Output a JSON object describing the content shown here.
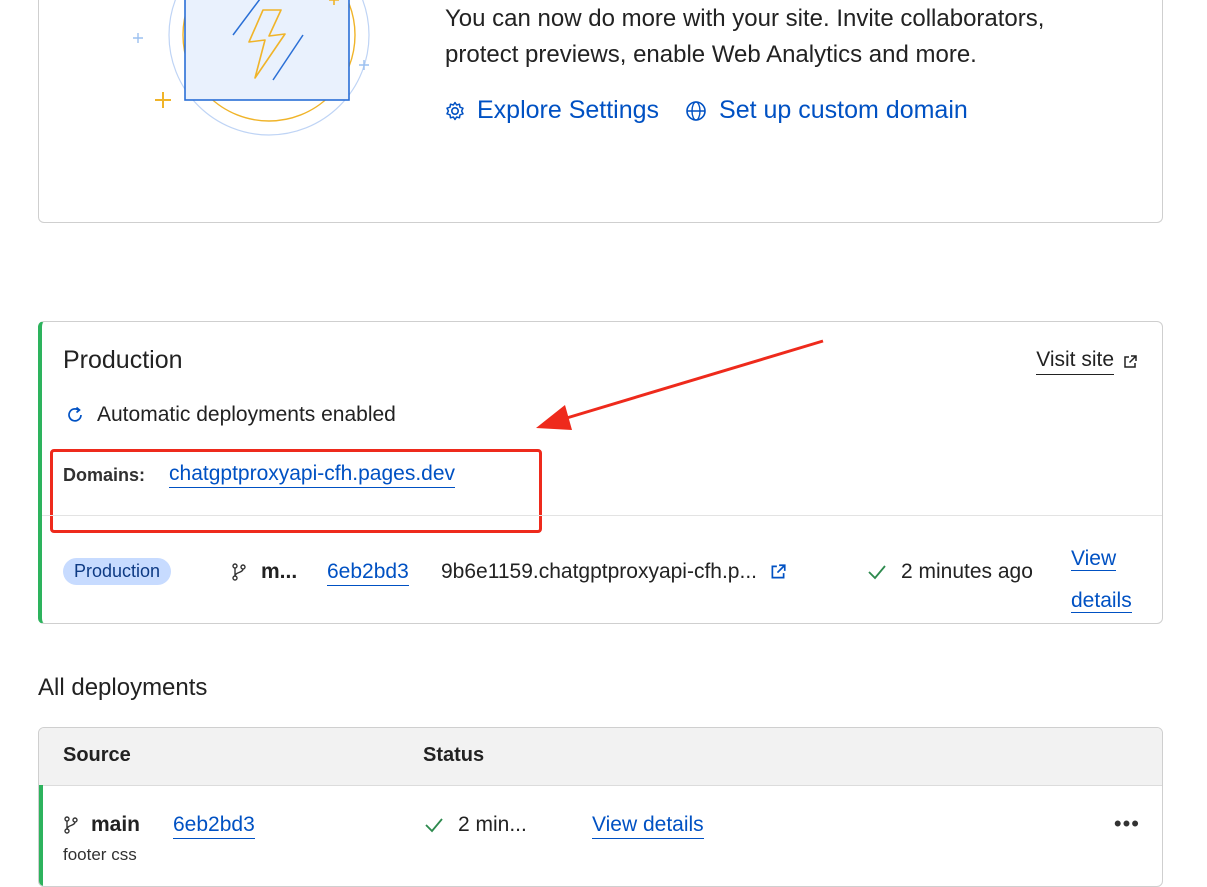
{
  "intro": {
    "line1": "You can now do more with your site. Invite collaborators,",
    "line2": "protect previews, enable Web Analytics and more.",
    "explore_settings": "Explore Settings",
    "custom_domain": "Set up custom domain"
  },
  "production": {
    "title": "Production",
    "visit_site": "Visit site",
    "auto_deployments": "Automatic deployments enabled",
    "domains_label": "Domains:",
    "domain": "chatgptproxyapi-cfh.pages.dev",
    "deployment": {
      "badge": "Production",
      "branch": "m...",
      "commit": "6eb2bd3",
      "preview_url": "9b6e1159.chatgptproxyapi-cfh.p...",
      "time": "2 minutes ago",
      "view_details_1": "View",
      "view_details_2": "details"
    }
  },
  "all_deployments": {
    "title": "All deployments",
    "columns": {
      "source": "Source",
      "status": "Status"
    },
    "rows": [
      {
        "branch": "main",
        "commit": "6eb2bd3",
        "message": "footer css",
        "time": "2 min...",
        "view_details": "View details"
      }
    ]
  },
  "colors": {
    "accent": "#0051c3",
    "success": "#2db35d",
    "annotation": "#ee2a1c",
    "badge_bg": "#c7dbff"
  },
  "icons": [
    "bolt-illustration",
    "gear-icon",
    "globe-icon",
    "external-link-icon",
    "refresh-icon",
    "branch-icon",
    "check-icon",
    "more-icon"
  ]
}
